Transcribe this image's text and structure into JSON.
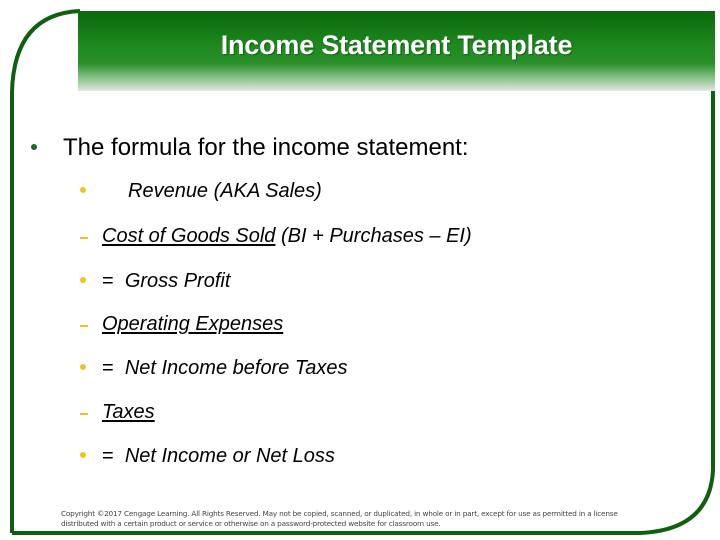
{
  "slide": {
    "title": "Income Statement Template",
    "colors": {
      "brand_green": "#0a690a",
      "frame_green": "#0e5f0e",
      "sub_bullet_yellow": "#f0c419",
      "main_bullet_green": "#1c6b1c"
    },
    "main_bullet": "The formula for the income statement:",
    "items": [
      {
        "marker": "dot",
        "operator": "",
        "text": "Revenue (AKA Sales)",
        "underlined": "",
        "suffix": ""
      },
      {
        "marker": "dash",
        "operator": "",
        "text": "",
        "underlined": "Cost of Goods Sold",
        "suffix": " (BI + Purchases – EI)"
      },
      {
        "marker": "dot",
        "operator": "=",
        "text": "Gross Profit",
        "underlined": "",
        "suffix": ""
      },
      {
        "marker": "dash",
        "operator": "",
        "text": "",
        "underlined": "Operating Expenses",
        "suffix": ""
      },
      {
        "marker": "dot",
        "operator": "=",
        "text": "Net Income before Taxes",
        "underlined": "",
        "suffix": ""
      },
      {
        "marker": "dash",
        "operator": "",
        "text": "",
        "underlined": "Taxes",
        "suffix": ""
      },
      {
        "marker": "dot",
        "operator": "=",
        "text": "Net Income or Net Loss",
        "underlined": "",
        "suffix": ""
      }
    ],
    "copyright": {
      "line1": "Copyright ©2017 Cengage Learning. All Rights Reserved. May not be copied, scanned, or duplicated, in whole or in part, except for use as permitted in a license",
      "line2": "distributed with a certain product or service or otherwise on a password-protected website for classroom use."
    }
  }
}
